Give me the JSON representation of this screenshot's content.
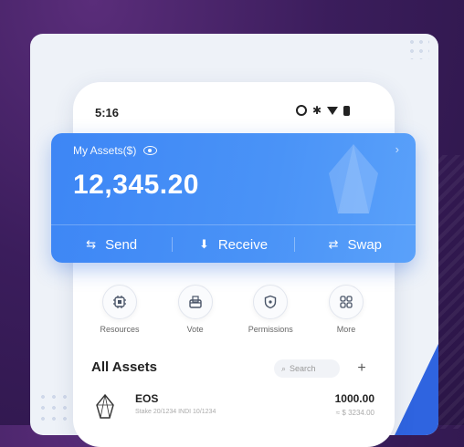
{
  "status": {
    "time": "5:16"
  },
  "assets": {
    "label": "My Assets($)",
    "balance": "12,345.20",
    "actions": [
      {
        "label": "Send",
        "icon": "send-icon"
      },
      {
        "label": "Receive",
        "icon": "download-icon"
      },
      {
        "label": "Swap",
        "icon": "swap-icon"
      }
    ]
  },
  "quick": [
    {
      "label": "Resources",
      "icon": "chip-icon"
    },
    {
      "label": "Vote",
      "icon": "ballot-box-icon"
    },
    {
      "label": "Permissions",
      "icon": "shield-icon"
    },
    {
      "label": "More",
      "icon": "grid-icon"
    }
  ],
  "all_assets": {
    "title": "All Assets",
    "search_placeholder": "Search",
    "add_label": "+",
    "rows": [
      {
        "name": "EOS",
        "sub": "Stake 20/1234   INDI 10/1234",
        "amount": "1000.00",
        "usd": "≈ $ 3234.00"
      }
    ]
  },
  "colors": {
    "accent": "#3d86f5",
    "background": "#3b1d5c",
    "card_bg": "#eef2f8"
  }
}
